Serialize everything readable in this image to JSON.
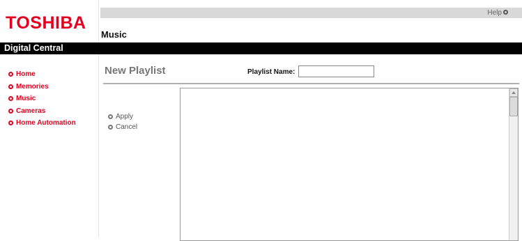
{
  "brand": {
    "logo": "TOSHIBA",
    "subtitle": "Digital Central"
  },
  "header": {
    "help_label": "Help",
    "section_title": "Music"
  },
  "nav": {
    "items": [
      {
        "label": "Home"
      },
      {
        "label": "Memories"
      },
      {
        "label": "Music"
      },
      {
        "label": "Cameras"
      },
      {
        "label": "Home Automation"
      }
    ]
  },
  "main": {
    "heading": "New Playlist",
    "playlist_name_label": "Playlist Name:",
    "playlist_name_value": "",
    "actions": {
      "apply": "Apply",
      "cancel": "Cancel"
    }
  },
  "colors": {
    "brand_red": "#e4001e",
    "bar_black": "#000000",
    "topbar_gray": "#d8d8d8",
    "heading_gray": "#777777"
  },
  "icons": {
    "nav_bullet": "circle-bullet-icon",
    "help": "circle-icon",
    "scroll_up": "arrow-up-icon"
  }
}
